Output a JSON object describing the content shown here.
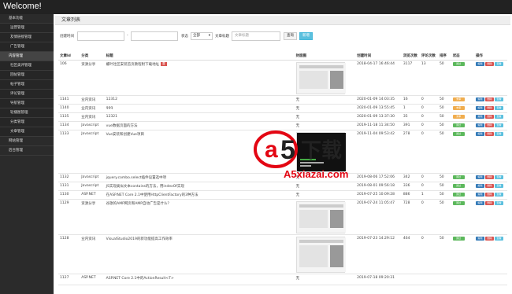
{
  "header": {
    "title": "Welcome!"
  },
  "sidebar": {
    "items": [
      {
        "label": "基本功能"
      },
      {
        "label": "运营管理"
      },
      {
        "label": "友情链接管理"
      },
      {
        "label": "广告管理"
      },
      {
        "label": "内容管理"
      },
      {
        "label": "社区类评管理"
      },
      {
        "label": "回帖管理"
      },
      {
        "label": "帖子管理"
      },
      {
        "label": "评论管理"
      },
      {
        "label": "导航管理"
      },
      {
        "label": "轮播图管理"
      },
      {
        "label": "分类管理"
      },
      {
        "label": "文章管理"
      },
      {
        "label": "网站管理"
      },
      {
        "label": "后台管理"
      }
    ]
  },
  "panel": {
    "title": "文章列表"
  },
  "filter": {
    "created_label": "创建时间",
    "range_sep": "-",
    "status_label": "状态",
    "status_value": "全部",
    "title_label": "文章标题",
    "title_placeholder": "文章标题",
    "search_label": "查询",
    "add_label": "新增"
  },
  "table": {
    "headers": [
      "文章Id",
      "分类",
      "标题",
      "封面图",
      "创建时间",
      "浏览次数",
      "评论次数",
      "排序",
      "状态",
      "操作"
    ],
    "rows": [
      {
        "id": "106",
        "cat": "资源分享",
        "title": "螺叶社区安装首页教程附下载地址",
        "tag": "置",
        "cover": "有图",
        "time": "2018-04-17 16:46:44",
        "views": "3117",
        "comments": "13",
        "sort": "50",
        "status": "通过",
        "st": "ok"
      },
      {
        "id": "1141",
        "cat": "业内资讯",
        "title": "12312",
        "tag": "",
        "cover": "无",
        "time": "2020-01-09 14:03:35",
        "views": "16",
        "comments": "0",
        "sort": "50",
        "status": "未审",
        "st": "no"
      },
      {
        "id": "1140",
        "cat": "业内资讯",
        "title": "qqq",
        "tag": "",
        "cover": "无",
        "time": "2020-01-09 13:55:45",
        "views": "1",
        "comments": "0",
        "sort": "50",
        "status": "未审",
        "st": "no"
      },
      {
        "id": "1135",
        "cat": "业内资讯",
        "title": "12321",
        "tag": "",
        "cover": "无",
        "time": "2020-01-09 13:37:30",
        "views": "35",
        "comments": "0",
        "sort": "50",
        "status": "未审",
        "st": "no"
      },
      {
        "id": "1134",
        "cat": "Javascript",
        "title": "vue数据页面的方法",
        "tag": "",
        "cover": "无",
        "time": "2019-11-18 11:34:50",
        "views": "391",
        "comments": "0",
        "sort": "50",
        "status": "通过",
        "st": "ok"
      },
      {
        "id": "1133",
        "cat": "Javascript",
        "title": "Vue安装和创建Vue项目",
        "tag": "",
        "cover": "有图",
        "time": "2019-11-04 09:53:42",
        "views": "278",
        "comments": "0",
        "sort": "50",
        "status": "通过",
        "st": "ok"
      },
      {
        "id": "1132",
        "cat": "Javascript",
        "title": "jquery.combo.select插件设置选中项",
        "tag": "",
        "cover": "无",
        "time": "2019-08-06 17:52:06",
        "views": "342",
        "comments": "0",
        "sort": "50",
        "status": "通过",
        "st": "ok"
      },
      {
        "id": "1131",
        "cat": "Javascript",
        "title": "JS实现类似文本contains的方法，用indexOf实现",
        "tag": "",
        "cover": "无",
        "time": "2019-08-01 09:56:18",
        "views": "336",
        "comments": "0",
        "sort": "50",
        "status": "通过",
        "st": "ok"
      },
      {
        "id": "1130",
        "cat": "ASP.NET",
        "title": "在ASP.NET Core 2.1中使用HttpClientFactory的3种方法",
        "tag": "",
        "cover": "无",
        "time": "2019-07-25 10:09:28",
        "views": "886",
        "comments": "1",
        "sort": "50",
        "status": "通过",
        "st": "ok"
      },
      {
        "id": "1129",
        "cat": "资源分享",
        "title": "谷歌的AMP网页和AMP自动广告是什么？",
        "tag": "",
        "cover": "有图",
        "time": "2019-07-24 11:05:47",
        "views": "728",
        "comments": "0",
        "sort": "50",
        "status": "通过",
        "st": "ok"
      },
      {
        "id": "1128",
        "cat": "业内资讯",
        "title": "VisualStudio2019的新功能提高工作效率",
        "tag": "",
        "cover": "有图",
        "time": "2019-07-23 14:29:12",
        "views": "464",
        "comments": "0",
        "sort": "50",
        "status": "通过",
        "st": "ok"
      },
      {
        "id": "1127",
        "cat": "ASP.NET",
        "title": "ASP.NET Core 2.1中的ActionResult<T>",
        "tag": "",
        "cover": "无",
        "time": "2019-07-18 09:20:31",
        "views": "",
        "comments": "",
        "sort": "",
        "status": "",
        "st": "ok"
      }
    ],
    "ops": {
      "edit": "编辑",
      "delete": "删除",
      "view": "查看"
    }
  },
  "watermark": {
    "brand": "a5下载",
    "domain": "A5xiazai.com"
  }
}
